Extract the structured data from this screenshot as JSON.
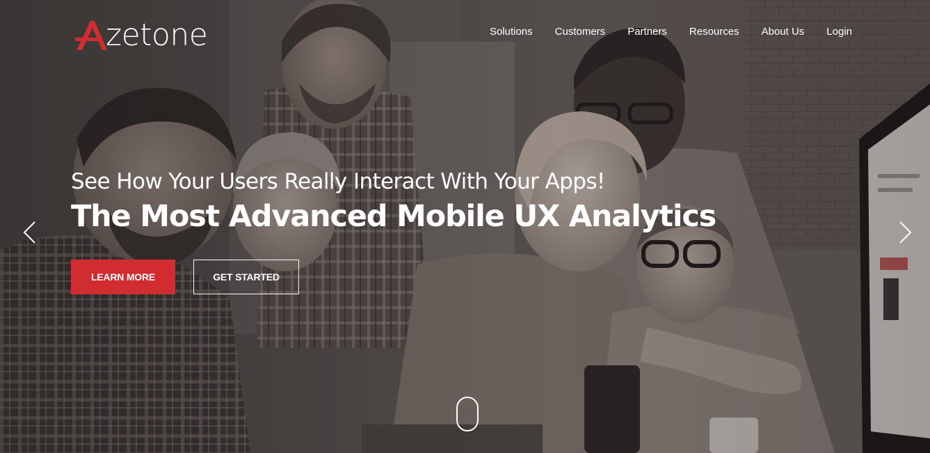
{
  "brand": {
    "logo_text": "zetone",
    "logo_letter": "A",
    "accent_color": "#d12c2f"
  },
  "nav": {
    "items": [
      {
        "label": "Solutions"
      },
      {
        "label": "Customers"
      },
      {
        "label": "Partners"
      },
      {
        "label": "Resources"
      },
      {
        "label": "About Us"
      },
      {
        "label": "Login"
      }
    ]
  },
  "hero": {
    "tagline": "See How Your Users Really Interact With Your Apps!",
    "headline": "The Most Advanced Mobile UX Analytics",
    "primary_button": "LEARN MORE",
    "secondary_button": "GET STARTED",
    "prev_icon": "chevron-left-icon",
    "next_icon": "chevron-right-icon",
    "scroll_icon": "mouse-scroll-icon"
  }
}
